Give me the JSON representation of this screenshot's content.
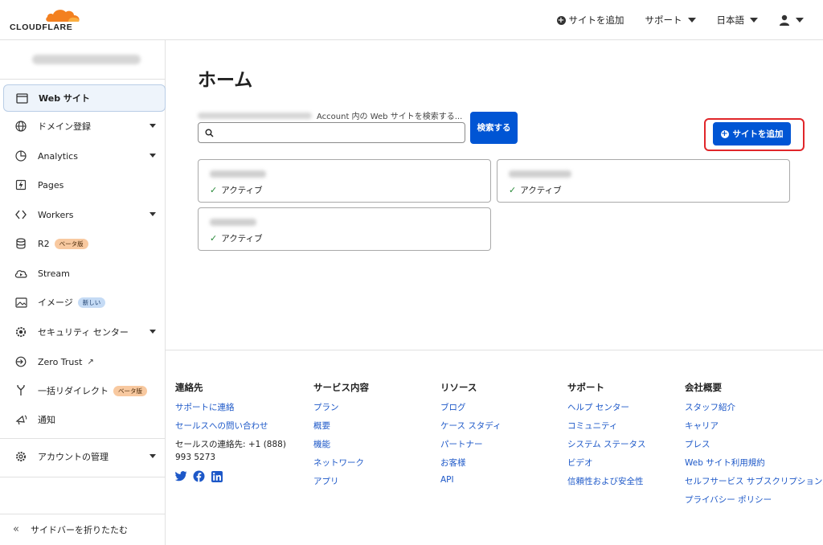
{
  "header": {
    "logo_text": "CLOUDFLARE",
    "add_site": "サイトを追加",
    "support": "サポート",
    "language": "日本語"
  },
  "sidebar": {
    "items": [
      {
        "label": "Web サイト",
        "icon": "browser-window-icon"
      },
      {
        "label": "ドメイン登録",
        "icon": "globe-icon"
      },
      {
        "label": "Analytics",
        "icon": "analytics-icon"
      },
      {
        "label": "Pages",
        "icon": "lightning-icon"
      },
      {
        "label": "Workers",
        "icon": "workers-icon"
      },
      {
        "label": "R2",
        "icon": "database-icon",
        "badge": "ベータ版"
      },
      {
        "label": "Stream",
        "icon": "cloud-play-icon"
      },
      {
        "label": "イメージ",
        "icon": "image-icon",
        "badge": "新しい"
      },
      {
        "label": "セキュリティ センター",
        "icon": "security-gear-icon"
      },
      {
        "label": "Zero Trust",
        "icon": "zero-trust-icon"
      },
      {
        "label": "一括リダイレクト",
        "icon": "redirect-icon",
        "badge": "ベータ版"
      },
      {
        "label": "通知",
        "icon": "broadcast-icon"
      },
      {
        "label": "アカウントの管理",
        "icon": "gear-icon"
      }
    ],
    "collapse_label": "サイドバーを折りたたむ"
  },
  "main": {
    "title": "ホーム",
    "search_label": "Account 内の Web サイトを検索する...",
    "search_button": "検索する",
    "add_site_button": "サイトを追加",
    "sites": [
      {
        "status": "アクティブ"
      },
      {
        "status": "アクティブ"
      },
      {
        "status": "アクティブ"
      }
    ]
  },
  "footer": {
    "contact": {
      "heading": "連絡先",
      "links": [
        "サポートに連絡",
        "セールスへの問い合わせ"
      ],
      "phone": "セールスの連絡先: +1 (888) 993 5273"
    },
    "services": {
      "heading": "サービス内容",
      "links": [
        "プラン",
        "概要",
        "機能",
        "ネットワーク",
        "アプリ"
      ]
    },
    "resources": {
      "heading": "リソース",
      "links": [
        "ブログ",
        "ケース スタディ",
        "パートナー",
        "お客様",
        "API"
      ]
    },
    "support": {
      "heading": "サポート",
      "links": [
        "ヘルプ センター",
        "コミュニティ",
        "システム ステータス",
        "ビデオ",
        "信頼性および安全性"
      ]
    },
    "company": {
      "heading": "会社概要",
      "links": [
        "スタッフ紹介",
        "キャリア",
        "プレス",
        "Web サイト利用規約",
        "セルフサービス サブスクリプション契約",
        "プライバシー ポリシー"
      ]
    }
  },
  "colors": {
    "primary": "#0055d4",
    "highlight": "#e0262a",
    "logo_orange": "#f38020"
  }
}
